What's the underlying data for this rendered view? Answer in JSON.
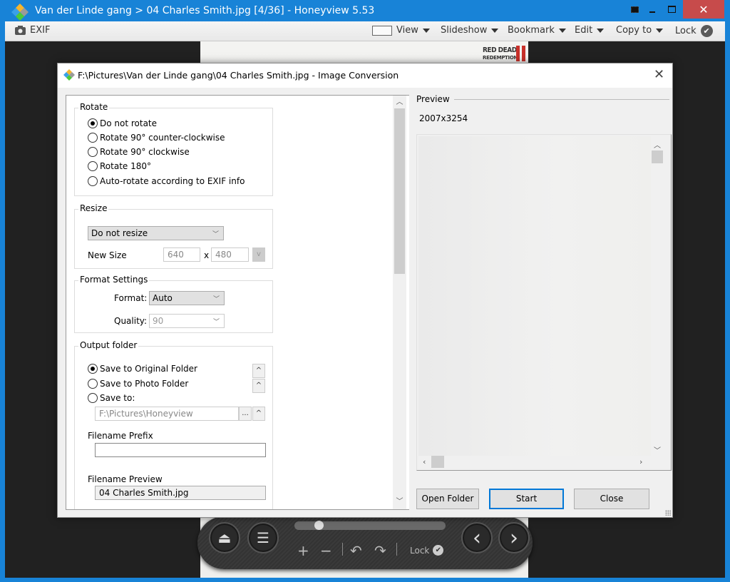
{
  "window": {
    "title": "Van der Linde gang > 04 Charles Smith.jpg [4/36] - Honeyview 5.53",
    "controls": {
      "fullscreen_icon": "fullscreen-icon",
      "minimize_icon": "minimize-icon",
      "maximize_icon": "maximize-icon",
      "close_glyph": "✕"
    },
    "accent_color": "#1883d7",
    "close_color": "#c74b4b"
  },
  "toolbar": {
    "exif_label": "EXIF",
    "view_label": "View",
    "slideshow_label": "Slideshow",
    "bookmark_label": "Bookmark",
    "edit_label": "Edit",
    "copy_to_label": "Copy to",
    "lock_label": "Lock"
  },
  "photo": {
    "logo_line1": "RED DEAD",
    "logo_line2": "REDEMPTION"
  },
  "control_bar": {
    "eject_glyph": "⏏",
    "menu_glyph": "☰",
    "zoom_in_glyph": "+",
    "zoom_out_glyph": "−",
    "rotate_left_glyph": "↶",
    "rotate_right_glyph": "↷",
    "prev_glyph": "‹",
    "next_glyph": "›",
    "lock_label": "Lock",
    "slider_position": 0.1
  },
  "dialog": {
    "title": "F:\\Pictures\\Van der Linde gang\\04 Charles Smith.jpg - Image Conversion",
    "close_glyph": "✕",
    "rotate": {
      "legend": "Rotate",
      "options": [
        {
          "label": "Do not rotate",
          "selected": true
        },
        {
          "label": "Rotate 90° counter-clockwise",
          "selected": false
        },
        {
          "label": "Rotate 90° clockwise",
          "selected": false
        },
        {
          "label": "Rotate 180°",
          "selected": false
        },
        {
          "label": "Auto-rotate according to EXIF info",
          "selected": false
        }
      ]
    },
    "resize": {
      "legend": "Resize",
      "mode": "Do not resize",
      "new_size_label": "New Size",
      "width": "640",
      "x_label": "x",
      "height": "480",
      "apply_label": "v"
    },
    "format": {
      "legend": "Format Settings",
      "format_label": "Format:",
      "format_value": "Auto",
      "quality_label": "Quality:",
      "quality_value": "90"
    },
    "output": {
      "legend": "Output folder",
      "options": [
        {
          "label": "Save to Original Folder",
          "selected": true
        },
        {
          "label": "Save to Photo Folder",
          "selected": false
        },
        {
          "label": "Save to:",
          "selected": false
        }
      ],
      "save_to_path": "F:\\Pictures\\Honeyview",
      "browse_label": "...",
      "expand_glyph": "^",
      "prefix_label": "Filename Prefix",
      "prefix_value": "",
      "preview_label": "Filename Preview",
      "preview_value": "04 Charles Smith.jpg"
    },
    "preview": {
      "label": "Preview",
      "dimensions": "2007x3254"
    },
    "buttons": {
      "open_folder": "Open Folder",
      "start": "Start",
      "close": "Close"
    }
  }
}
